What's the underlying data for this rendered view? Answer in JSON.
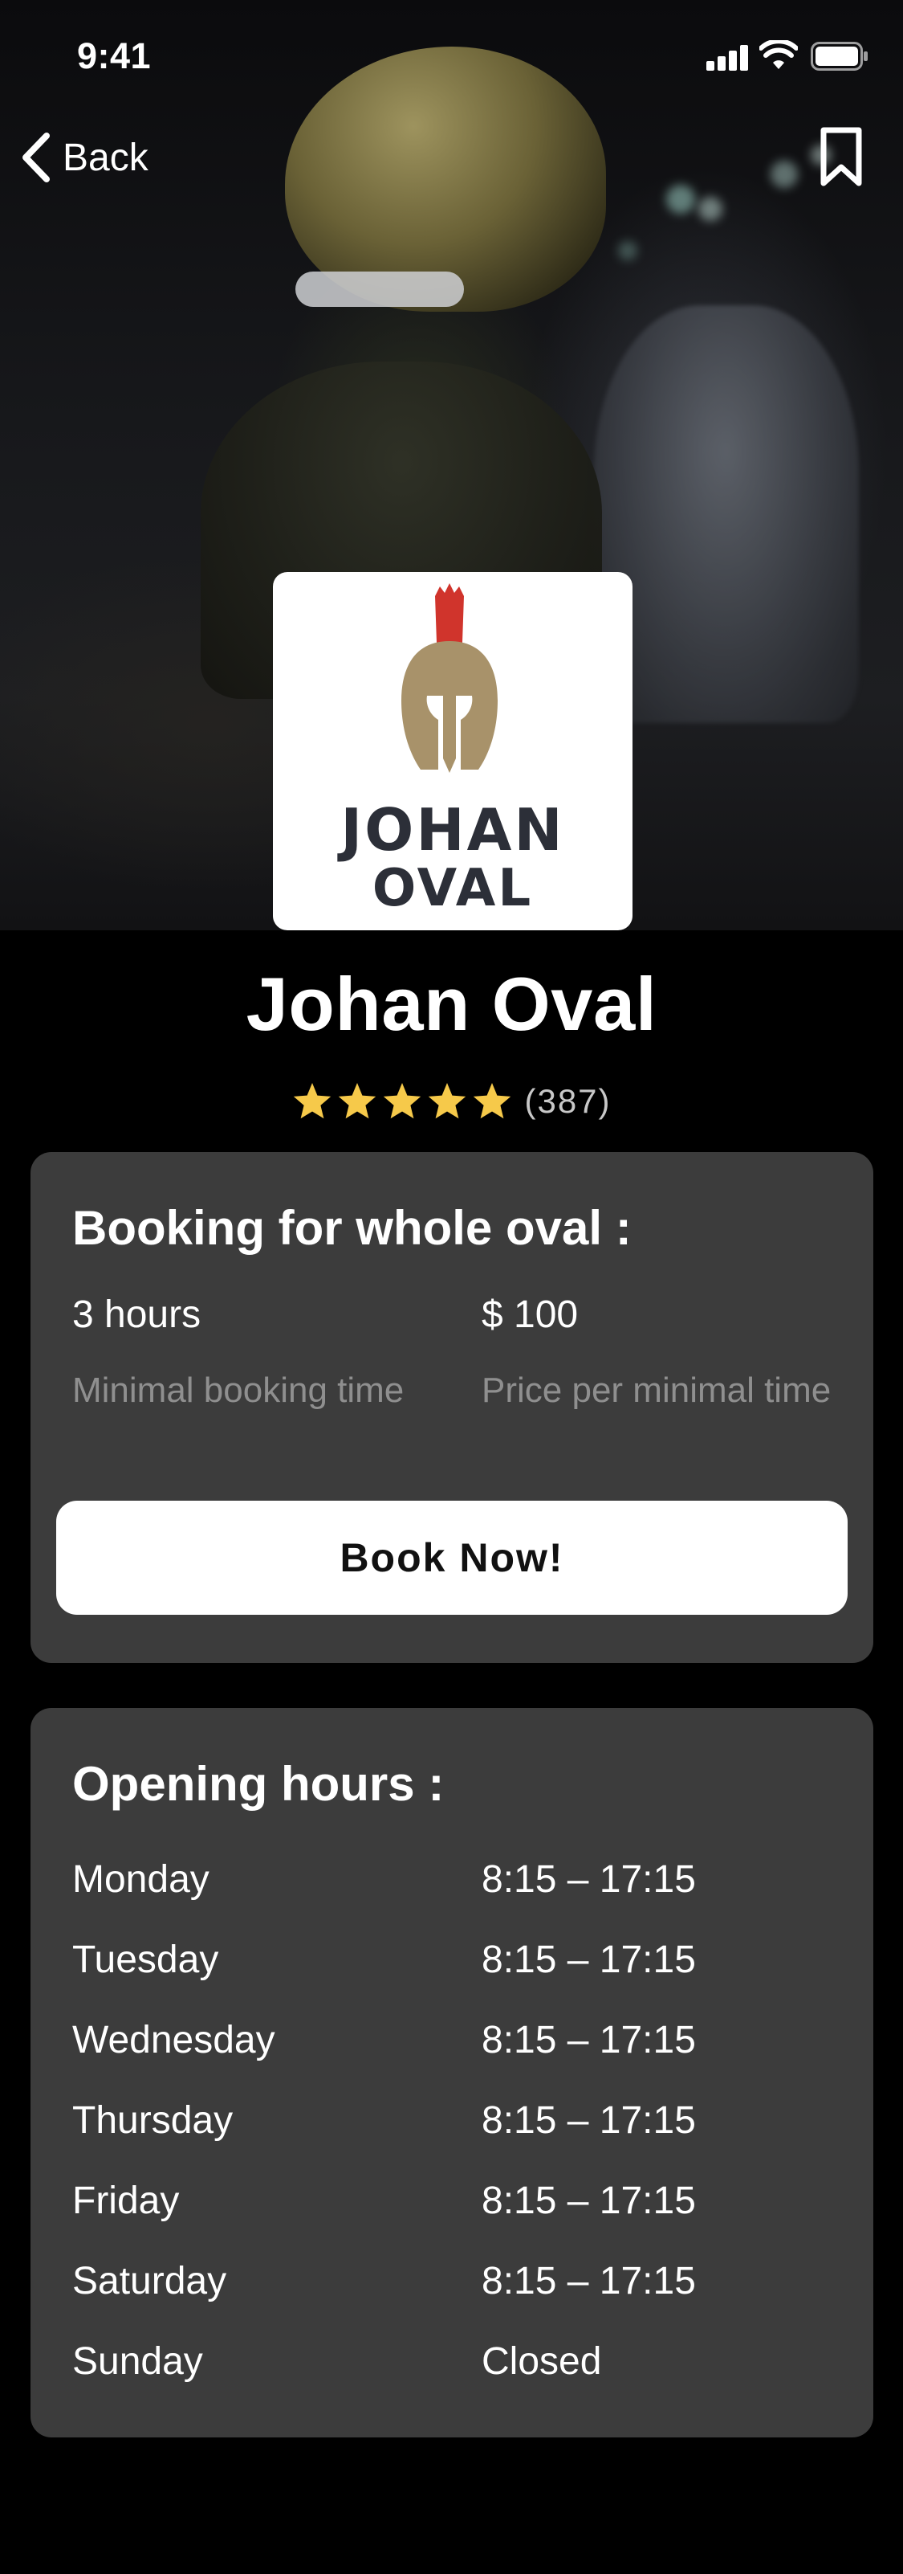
{
  "status_bar": {
    "time": "9:41",
    "icons": [
      "cellular-signal-icon",
      "wifi-icon",
      "battery-icon"
    ]
  },
  "nav": {
    "back_label": "Back",
    "back_icon": "chevron-left-icon",
    "bookmark_icon": "bookmark-icon"
  },
  "venue": {
    "logo_line1": "JOHAN",
    "logo_line2": "OVAL",
    "logo_icon": "spartan-helmet-icon",
    "name": "Johan Oval",
    "rating_stars": 5,
    "review_count": "(387)"
  },
  "booking": {
    "title": "Booking for whole oval :",
    "min_time_value": "3 hours",
    "min_time_label": "Minimal booking time",
    "price_value": "$ 100",
    "price_label": "Price per minimal time",
    "book_button_label": "Book Now!"
  },
  "opening_hours": {
    "title": "Opening hours :",
    "rows": [
      {
        "day": "Monday",
        "time": "8:15 – 17:15"
      },
      {
        "day": "Tuesday",
        "time": "8:15 – 17:15"
      },
      {
        "day": "Wednesday",
        "time": "8:15 – 17:15"
      },
      {
        "day": "Thursday",
        "time": "8:15 – 17:15"
      },
      {
        "day": "Friday",
        "time": "8:15 – 17:15"
      },
      {
        "day": "Saturday",
        "time": "8:15 – 17:15"
      },
      {
        "day": "Sunday",
        "time": "Closed"
      }
    ]
  },
  "colors": {
    "background": "#000000",
    "card": "#3c3c3c",
    "star": "#f6c94a",
    "muted_text": "#8f8f8f",
    "logo_text": "#2c2f38",
    "logo_helmet": "#a8926a",
    "logo_plume": "#d0342c"
  }
}
